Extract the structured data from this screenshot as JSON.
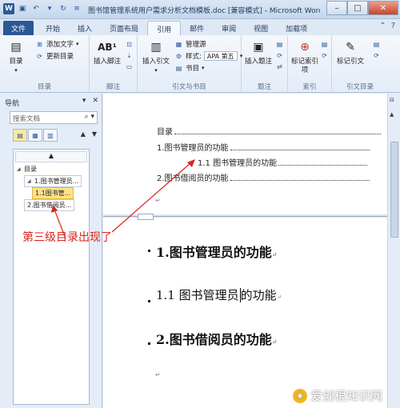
{
  "titlebar": {
    "title": "图书馆管理系统用户需求分析文档模板.doc [兼容模式] - Microsoft Word",
    "minimize": "–",
    "maximize": "□",
    "close": "✕"
  },
  "tabs": [
    "文件",
    "开始",
    "插入",
    "页面布局",
    "引用",
    "邮件",
    "审阅",
    "视图",
    "加载项"
  ],
  "ribbon": {
    "toc_group": {
      "label": "目录",
      "toc_button": "目录",
      "add_text": "添加文字",
      "update_toc": "更新目录"
    },
    "footnote_group": {
      "label": "脚注",
      "insert_footnote": "插入脚注",
      "ab_icon": "AB¹"
    },
    "citation_group": {
      "label": "引文与书目",
      "insert_citation": "插入引文",
      "manage_sources": "管理源",
      "style_label": "样式:",
      "style_value": "APA 第五",
      "bibliography": "书目"
    },
    "caption_group": {
      "label": "题注",
      "insert_caption": "插入题注"
    },
    "index_group": {
      "label": "索引",
      "mark_entry": "标记索引项"
    },
    "toa_group": {
      "label": "引文目录",
      "mark_citation": "标记引文"
    }
  },
  "nav": {
    "title": "导航",
    "search_placeholder": "搜索文档",
    "tree_top": "▲",
    "tree": [
      {
        "label": "目录",
        "level": 1
      },
      {
        "label": "1.图书管理员...",
        "level": 2
      },
      {
        "label": "1.1图书管...",
        "level": 3,
        "selected": true
      },
      {
        "label": "2.图书借阅员...",
        "level": 2
      }
    ]
  },
  "document": {
    "toc_title": "目录",
    "toc_entries": [
      "1.图书管理员的功能",
      "1.1 图书管理员的功能",
      "2.图书借阅员的功能"
    ],
    "heading1": "1.图书管理员的功能",
    "heading2_prefix": "1.1 图书管理员",
    "heading2_suffix": "的功能",
    "heading3": "2.图书借阅员的功能",
    "para_mark": "↵"
  },
  "annotation": "第三级目录出现了",
  "watermark": "爱创根知识网",
  "colors": {
    "accent": "#2b5797",
    "annotation": "#d9241c",
    "selection": "#fde28b"
  }
}
